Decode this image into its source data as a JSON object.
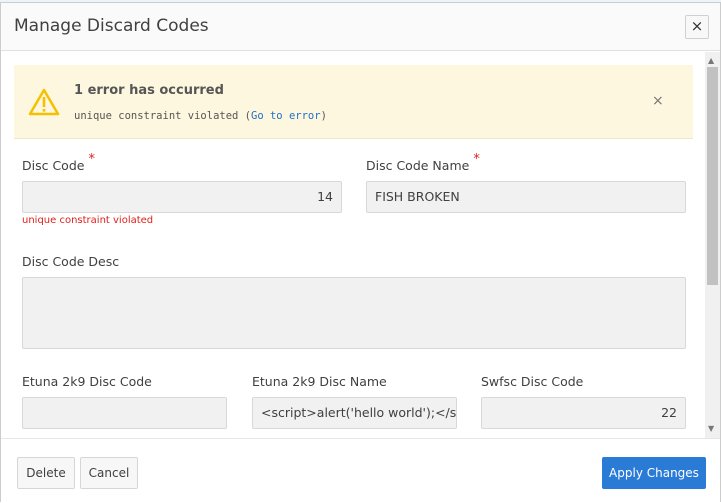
{
  "dialog": {
    "title": "Manage Discard Codes",
    "close_label": "×"
  },
  "alert": {
    "icon": "warning-icon",
    "heading": "1 error has occurred",
    "message_prefix": "unique constraint violated (",
    "link": "Go to error",
    "message_suffix": ")",
    "close_label": "×",
    "background": "#fef7e0"
  },
  "form": {
    "disc_code": {
      "label": "Disc Code",
      "required": "*",
      "value": "14",
      "error": "unique constraint violated"
    },
    "disc_code_name": {
      "label": "Disc Code Name",
      "required": "*",
      "value": "FISH BROKEN"
    },
    "disc_code_desc": {
      "label": "Disc Code Desc",
      "value": ""
    },
    "etuna_disc_code": {
      "label": "Etuna 2k9 Disc Code",
      "value": ""
    },
    "etuna_disc_name": {
      "label": "Etuna 2k9 Disc Name",
      "value": "<script>alert('hello world');</script>"
    },
    "swfsc_disc_code": {
      "label": "Swfsc Disc Code",
      "value": "22"
    }
  },
  "footer": {
    "delete": "Delete",
    "cancel": "Cancel",
    "apply": "Apply Changes",
    "accent": "#2a7bd6"
  }
}
